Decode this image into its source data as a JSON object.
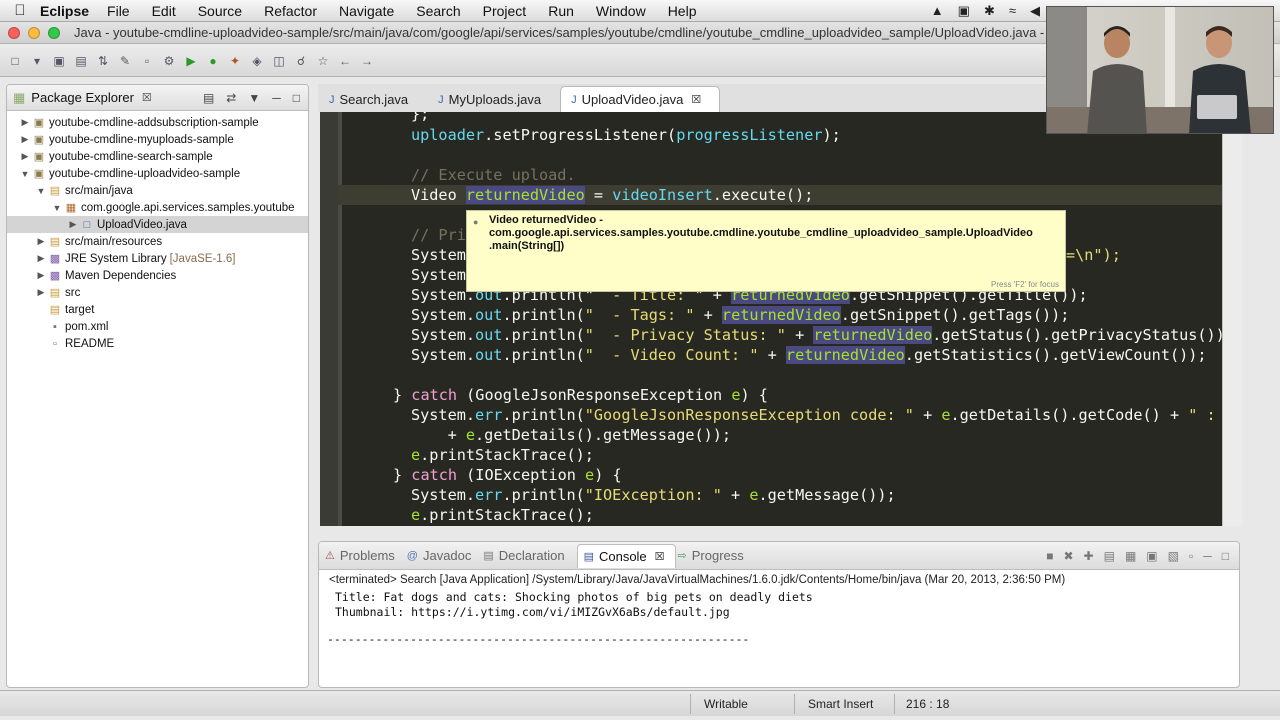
{
  "menubar": {
    "app": "Eclipse",
    "items": [
      "File",
      "Edit",
      "Source",
      "Refactor",
      "Navigate",
      "Search",
      "Project",
      "Run",
      "Window",
      "Help"
    ]
  },
  "window": {
    "title": "Java - youtube-cmdline-uploadvideo-sample/src/main/java/com/google/api/services/samples/youtube/cmdline/youtube_cmdline_uploadvideo_sample/UploadVideo.java - Eclipse"
  },
  "package_explorer": {
    "title": "Package Explorer",
    "tree": [
      {
        "label": "youtube-cmdline-addsubscription-sample",
        "expanded": false
      },
      {
        "label": "youtube-cmdline-myuploads-sample",
        "expanded": false
      },
      {
        "label": "youtube-cmdline-search-sample",
        "expanded": false
      },
      {
        "label": "youtube-cmdline-uploadvideo-sample",
        "expanded": true
      },
      {
        "label": "src/main/java",
        "expanded": true
      },
      {
        "label": "com.google.api.services.samples.youtube",
        "expanded": true
      },
      {
        "label": "UploadVideo.java",
        "selected": true
      },
      {
        "label": "src/main/resources"
      },
      {
        "label": "JRE System Library",
        "suffix": "[JavaSE-1.6]"
      },
      {
        "label": "Maven Dependencies"
      },
      {
        "label": "src"
      },
      {
        "label": "target"
      },
      {
        "label": "pom.xml"
      },
      {
        "label": "README"
      }
    ]
  },
  "editor": {
    "tabs": [
      {
        "label": "Search.java",
        "active": false
      },
      {
        "label": "MyUploads.java",
        "active": false
      },
      {
        "label": "UploadVideo.java",
        "active": true
      }
    ],
    "lines": {
      "l0": "};",
      "l1a": "uploader",
      "l1b": ".setProgressListener(",
      "l1c": "progressListener",
      "l1d": ");",
      "l2": "// Execute upload.",
      "l3a": "Video ",
      "l3b": "returnedVideo",
      "l3c": " = ",
      "l3d": "videoInsert",
      "l3e": ".execute();",
      "l4": "// Pri",
      "l5a": "System",
      "l5b": "=\\n\");",
      "l6a": "System",
      "l7a": "System.",
      "l7b": "out",
      "l7c": ".println(\"",
      "l7d": "  - Title: \"",
      "l7e": " + ",
      "l7f": "returnedVideo",
      "l7g": ".getSnippet().getTitle());",
      "l8a": "System.",
      "l8b": "out",
      "l8c": ".println(",
      "l8d": "\"  - Tags: \"",
      "l8e": " + ",
      "l8f": "returnedVideo",
      "l8g": ".getSnippet().getTags());",
      "l9a": "System.",
      "l9b": "out",
      "l9c": ".println(",
      "l9d": "\"  - Privacy Status: \"",
      "l9e": " + ",
      "l9f": "returnedVideo",
      "l9g": ".getStatus().getPrivacyStatus());",
      "l10a": "System.",
      "l10b": "out",
      "l10c": ".println(",
      "l10d": "\"  - Video Count: \"",
      "l10e": " + ",
      "l10f": "returnedVideo",
      "l10g": ".getStatistics().getViewCount());",
      "l11a": "} ",
      "l11b": "catch",
      "l11c": " (GoogleJsonResponseException ",
      "l11d": "e",
      "l11e": ") {",
      "l12a": "System.",
      "l12b": "err",
      "l12c": ".println(",
      "l12d": "\"GoogleJsonResponseException code: \"",
      "l12e": " + ",
      "l12f": "e",
      "l12g": ".getDetails().getCode() + ",
      "l12h": "\" : \"",
      "l13a": "    + ",
      "l13b": "e",
      "l13c": ".getDetails().getMessage());",
      "l14a": "e",
      "l14b": ".printStackTrace();",
      "l15a": "} ",
      "l15b": "catch",
      "l15c": " (IOException ",
      "l15d": "e",
      "l15e": ") {",
      "l16a": "System.",
      "l16b": "err",
      "l16c": ".println(",
      "l16d": "\"IOException: \"",
      "l16e": " + ",
      "l16f": "e",
      "l16g": ".getMessage());",
      "l17a": "e",
      "l17b": ".printStackTrace();"
    },
    "hover": {
      "line1": "Video returnedVideo -",
      "line2": "com.google.api.services.samples.youtube.cmdline.youtube_cmdline_uploadvideo_sample.UploadVideo",
      "line3": ".main(String[])",
      "hint": "Press 'F2' for focus"
    }
  },
  "bottom": {
    "tabs": [
      {
        "label": "Problems",
        "active": false
      },
      {
        "label": "Javadoc",
        "active": false
      },
      {
        "label": "Declaration",
        "active": false
      },
      {
        "label": "Console",
        "active": true
      },
      {
        "label": "Progress",
        "active": false
      }
    ],
    "console": {
      "terminated": "<terminated> Search [Java Application] /System/Library/Java/JavaVirtualMachines/1.6.0.jdk/Contents/Home/bin/java (Mar 20, 2013, 2:36:50 PM)",
      "line1": "Title: Fat dogs and cats: Shocking photos of big pets on deadly diets",
      "line2": "Thumbnail: https://i.ytimg.com/vi/iMIZGvX6aBs/default.jpg",
      "dashes": "-------------------------------------------------------------"
    }
  },
  "status": {
    "writable": "Writable",
    "insert": "Smart Insert",
    "position": "216 : 18"
  },
  "colors": {
    "editor_bg": "#272822",
    "keyword": "#f0a0d0",
    "comment": "#75715e",
    "string": "#e6db74",
    "variable": "#a6e22e",
    "field": "#66d9ef"
  }
}
